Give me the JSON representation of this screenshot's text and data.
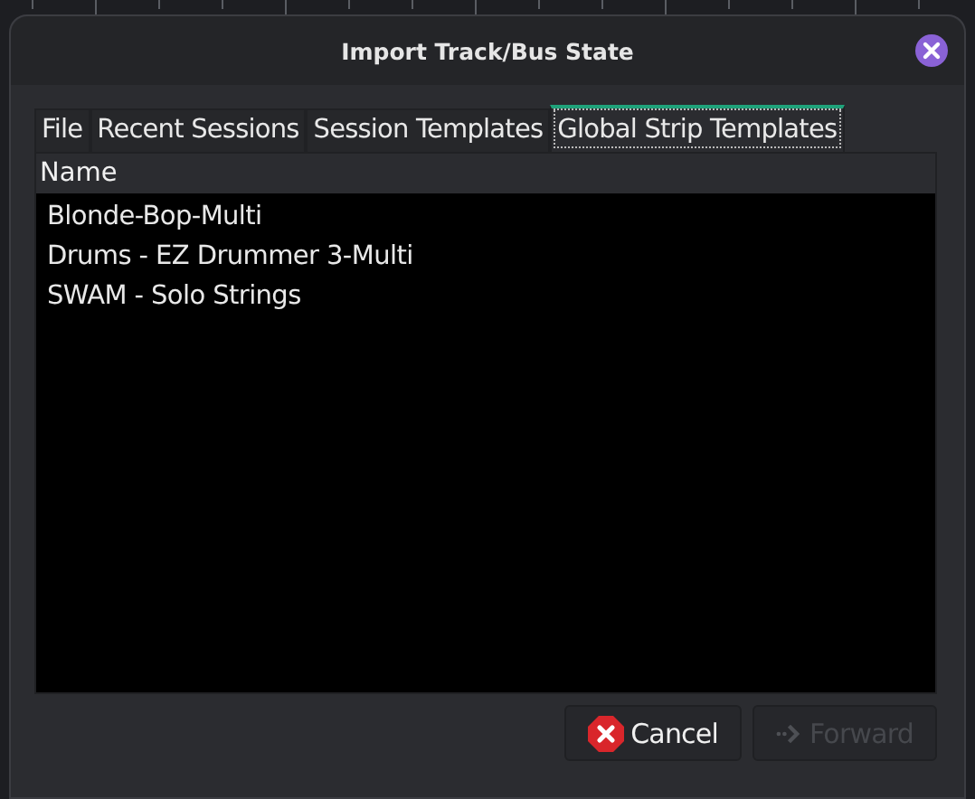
{
  "window": {
    "title": "Import Track/Bus State"
  },
  "tabs": [
    {
      "label": "File",
      "selected": false
    },
    {
      "label": "Recent Sessions",
      "selected": false
    },
    {
      "label": "Session Templates",
      "selected": false
    },
    {
      "label": "Global Strip Templates",
      "selected": true
    }
  ],
  "table": {
    "columns": [
      "Name"
    ],
    "rows": [
      {
        "name": "Blonde-Bop-Multi",
        "selected": false
      },
      {
        "name": "Drums - EZ Drummer 3-Multi",
        "selected": false
      },
      {
        "name": "SWAM - Solo Strings",
        "selected": false
      }
    ]
  },
  "buttons": [
    {
      "label": "Cancel",
      "kind": "cancel",
      "disabled": false
    },
    {
      "label": "Forward",
      "kind": "forward",
      "disabled": true
    }
  ]
}
